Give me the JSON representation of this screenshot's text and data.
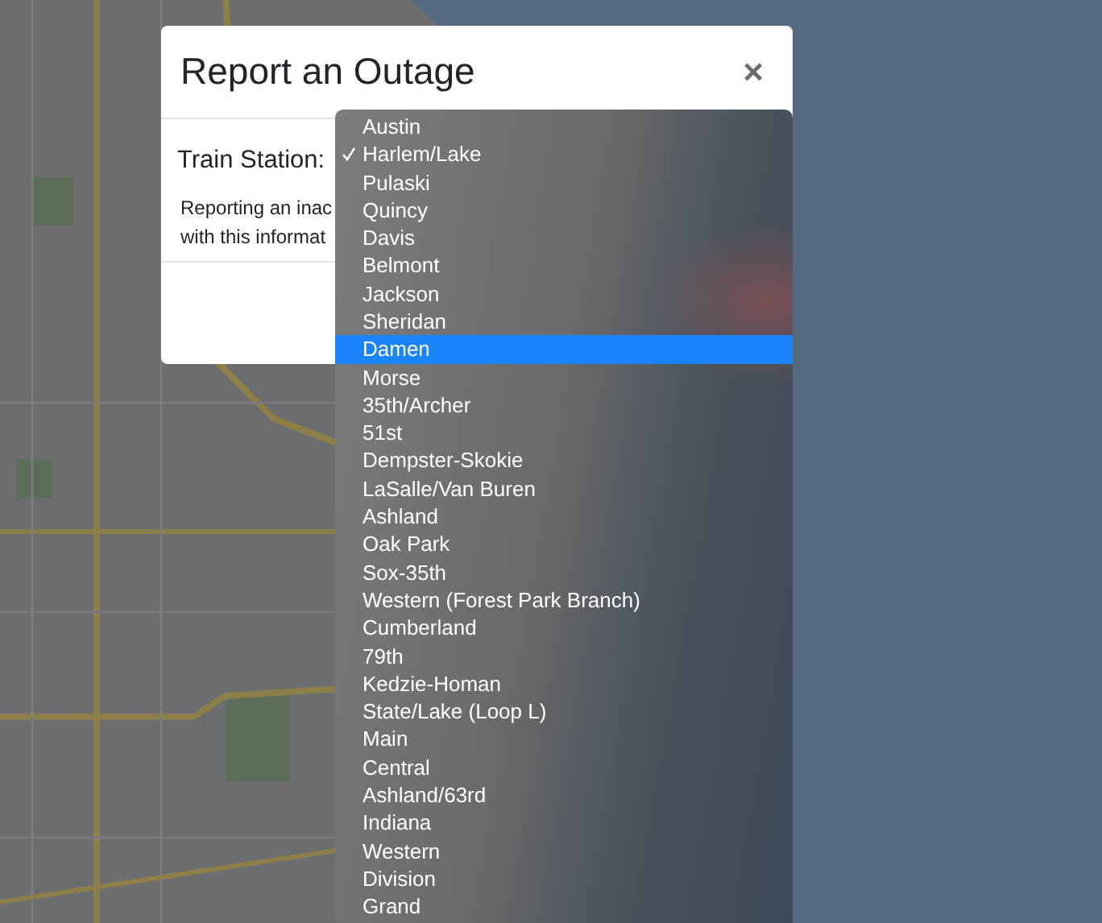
{
  "modal": {
    "title": "Report an Outage",
    "close": "×",
    "field_label": "Train Station:",
    "description_lines": [
      "Reporting an inac",
      "with this informat"
    ]
  },
  "dropdown": {
    "options": [
      {
        "label": "Austin",
        "selected": false,
        "highlighted": false
      },
      {
        "label": "Harlem/Lake",
        "selected": true,
        "highlighted": false
      },
      {
        "label": "Pulaski",
        "selected": false,
        "highlighted": false
      },
      {
        "label": "Quincy",
        "selected": false,
        "highlighted": false
      },
      {
        "label": "Davis",
        "selected": false,
        "highlighted": false
      },
      {
        "label": "Belmont",
        "selected": false,
        "highlighted": false
      },
      {
        "label": "Jackson",
        "selected": false,
        "highlighted": false
      },
      {
        "label": "Sheridan",
        "selected": false,
        "highlighted": false
      },
      {
        "label": "Damen",
        "selected": false,
        "highlighted": true
      },
      {
        "label": "Morse",
        "selected": false,
        "highlighted": false
      },
      {
        "label": "35th/Archer",
        "selected": false,
        "highlighted": false
      },
      {
        "label": "51st",
        "selected": false,
        "highlighted": false
      },
      {
        "label": "Dempster-Skokie",
        "selected": false,
        "highlighted": false
      },
      {
        "label": "LaSalle/Van Buren",
        "selected": false,
        "highlighted": false
      },
      {
        "label": "Ashland",
        "selected": false,
        "highlighted": false
      },
      {
        "label": "Oak Park",
        "selected": false,
        "highlighted": false
      },
      {
        "label": "Sox-35th",
        "selected": false,
        "highlighted": false
      },
      {
        "label": "Western (Forest Park Branch)",
        "selected": false,
        "highlighted": false
      },
      {
        "label": "Cumberland",
        "selected": false,
        "highlighted": false
      },
      {
        "label": "79th",
        "selected": false,
        "highlighted": false
      },
      {
        "label": "Kedzie-Homan",
        "selected": false,
        "highlighted": false
      },
      {
        "label": "State/Lake (Loop L)",
        "selected": false,
        "highlighted": false
      },
      {
        "label": "Main",
        "selected": false,
        "highlighted": false
      },
      {
        "label": "Central",
        "selected": false,
        "highlighted": false
      },
      {
        "label": "Ashland/63rd",
        "selected": false,
        "highlighted": false
      },
      {
        "label": "Indiana",
        "selected": false,
        "highlighted": false
      },
      {
        "label": "Western",
        "selected": false,
        "highlighted": false
      },
      {
        "label": "Division",
        "selected": false,
        "highlighted": false
      },
      {
        "label": "Grand",
        "selected": false,
        "highlighted": false
      }
    ]
  }
}
